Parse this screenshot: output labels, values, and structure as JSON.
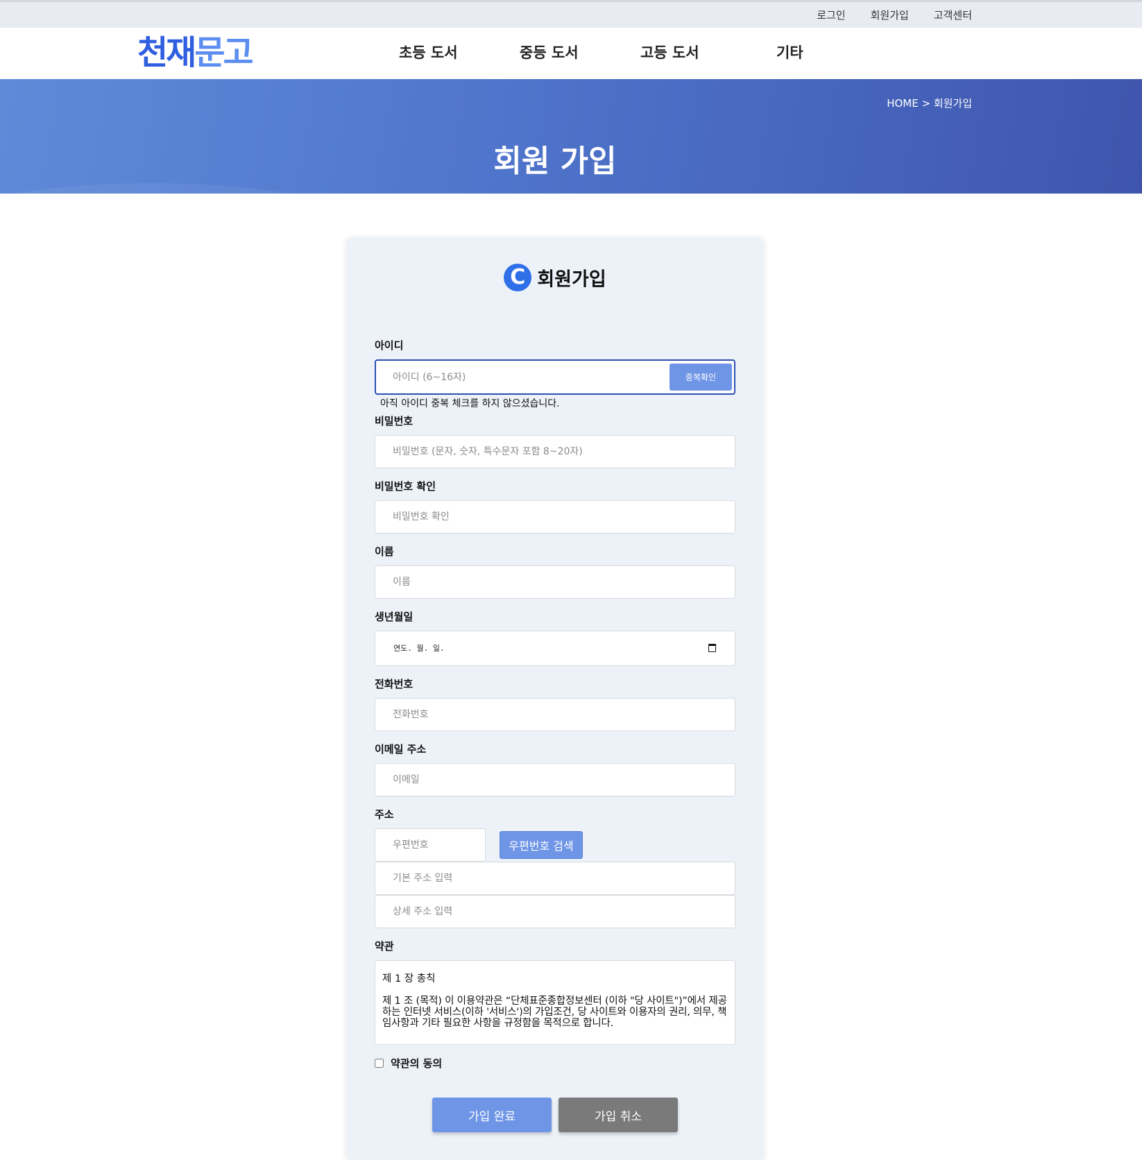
{
  "topbar": {
    "links": [
      "로그인",
      "회원가입",
      "고객센터"
    ]
  },
  "header": {
    "logo_part1": "천재",
    "logo_part2": "문고",
    "nav": [
      "초등 도서",
      "중등 도서",
      "고등 도서",
      "기타"
    ]
  },
  "banner": {
    "breadcrumb": "HOME > 회원가입",
    "title": "회원 가입"
  },
  "form": {
    "logo_letter": "C",
    "title": "회원가입",
    "id": {
      "label": "아이디",
      "placeholder": "아이디 (6~16자)",
      "check_button": "중복확인",
      "hint": "아직 아이디 중복 체크를 하지 않으셨습니다."
    },
    "password": {
      "label": "비밀번호",
      "placeholder": "비밀번호 (문자, 숫자, 특수문자 포함 8~20자)"
    },
    "password_confirm": {
      "label": "비밀번호 확인",
      "placeholder": "비밀번호 확인"
    },
    "name": {
      "label": "이름",
      "placeholder": "이름"
    },
    "birth": {
      "label": "생년월일",
      "placeholder": "연도. 월. 일."
    },
    "phone": {
      "label": "전화번호",
      "placeholder": "전화번호"
    },
    "email": {
      "label": "이메일 주소",
      "placeholder": "이메일"
    },
    "address": {
      "label": "주소",
      "zip_placeholder": "우편번호",
      "zip_button": "우편번호 검색",
      "base_placeholder": "기본 주소 입력",
      "detail_placeholder": "상세 주소 입력"
    },
    "terms": {
      "label": "약관",
      "heading": "제 1 장 총칙",
      "body": "제 1 조 (목적) 이 이용약관은 “단체표준종합정보센터 (이하 \"당 사이트\")”에서 제공하는 인터넷 서비스(이하 '서비스')의 가입조건, 당 사이트와 이용자의 권리, 의무, 책임사항과 기타 필요한 사항을 규정함을 목적으로 합니다.",
      "agree_label": "약관의 동의"
    },
    "buttons": {
      "submit": "가입 완료",
      "cancel": "가입 취소"
    }
  }
}
